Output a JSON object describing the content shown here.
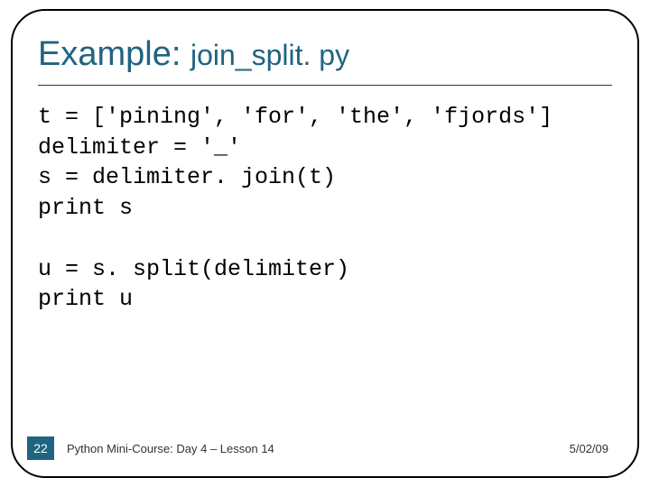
{
  "title": {
    "strong": "Example:",
    "light": "join_split. py"
  },
  "code": "t = ['pining', 'for', 'the', 'fjords']\ndelimiter = '_'\ns = delimiter. join(t)\nprint s\n\nu = s. split(delimiter)\nprint u",
  "footer": {
    "page": "22",
    "text": "Python Mini-Course: Day 4 – Lesson 14",
    "date": "5/02/09"
  }
}
